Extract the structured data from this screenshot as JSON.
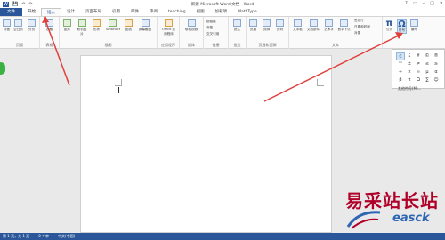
{
  "window": {
    "title": "新建 Microsoft Word 文档 - Word",
    "app_badge": "W",
    "controls": [
      "?",
      "▭",
      "–",
      "□",
      "✕"
    ]
  },
  "quick_access": [
    "💾",
    "↶",
    "↷",
    "⋯"
  ],
  "tabs": [
    {
      "label": "文件",
      "state": "file"
    },
    {
      "label": "开始",
      "state": ""
    },
    {
      "label": "插入",
      "state": "active"
    },
    {
      "label": "设计",
      "state": ""
    },
    {
      "label": "页面布局",
      "state": ""
    },
    {
      "label": "引用",
      "state": ""
    },
    {
      "label": "邮件",
      "state": ""
    },
    {
      "label": "审阅",
      "state": ""
    },
    {
      "label": "teaching",
      "state": ""
    },
    {
      "label": "视图",
      "state": ""
    },
    {
      "label": "加载项",
      "state": ""
    },
    {
      "label": "MathType",
      "state": ""
    }
  ],
  "ribbon": {
    "groups": [
      {
        "name": "页面",
        "buttons": [
          "封面",
          "空白页",
          "分页"
        ]
      },
      {
        "name": "表格",
        "buttons": [
          "表格"
        ]
      },
      {
        "name": "插图",
        "buttons": [
          "图片",
          "联机图片",
          "形状",
          "SmartArt",
          "图表",
          "屏幕截图"
        ]
      },
      {
        "name": "应用程序",
        "buttons": [
          "Office 应用程序"
        ]
      },
      {
        "name": "媒体",
        "buttons": [
          "联机视频"
        ]
      },
      {
        "name": "链接",
        "buttons": [
          "超链接",
          "书签",
          "交叉引用"
        ]
      },
      {
        "name": "批注",
        "buttons": [
          "批注"
        ]
      },
      {
        "name": "页眉和页脚",
        "buttons": [
          "页眉",
          "页脚",
          "页码"
        ]
      },
      {
        "name": "文本",
        "buttons": [
          "文本框",
          "文档部件",
          "艺术字",
          "首字下沉"
        ]
      },
      {
        "name": "",
        "buttons": [
          "公式",
          "符号",
          "编号"
        ]
      }
    ],
    "text_small": [
      "签名行",
      "日期和时间",
      "对象"
    ]
  },
  "symbols_dropdown": {
    "grid": [
      "€",
      "£",
      "¥",
      "©",
      "®",
      "™",
      "±",
      "≠",
      "≤",
      "≥",
      "÷",
      "×",
      "∞",
      "µ",
      "α",
      "β",
      "π",
      "Ω",
      "∑",
      "☺"
    ],
    "more_label": "其他符号(M)..."
  },
  "status_bar": {
    "page": "第 1 页，共 1 页",
    "words": "0 个字",
    "language": "中文(中国)"
  },
  "watermark": {
    "cn": "易采站长站",
    "en": "easck"
  },
  "colors": {
    "accent": "#2b579a",
    "arrow": "#e0403a"
  }
}
